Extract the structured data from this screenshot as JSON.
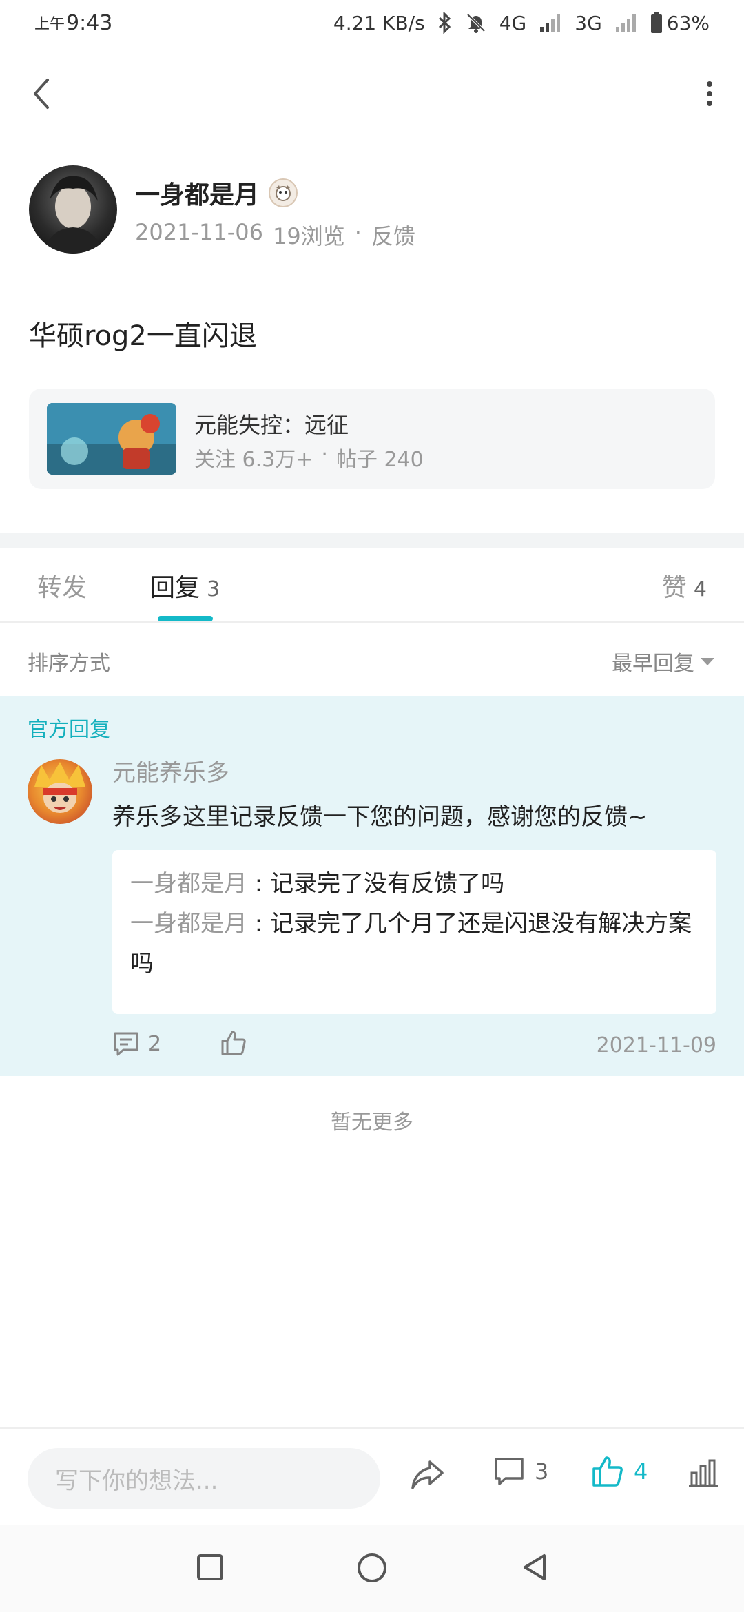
{
  "status": {
    "time_prefix": "上午",
    "time": "9:43",
    "net_speed": "4.21 KB/s",
    "net1": "4G",
    "net2": "3G",
    "battery": "63%"
  },
  "author": {
    "name": "一身都是月",
    "date": "2021-11-06",
    "views": "19浏览",
    "separator": "·",
    "category": "反馈"
  },
  "post": {
    "title": "华硕rog2一直闪退"
  },
  "game": {
    "name": "元能失控：远征",
    "follow": "关注 6.3万+",
    "separator": "·",
    "posts": "帖子 240"
  },
  "tabs": {
    "forward": "转发",
    "reply": "回复",
    "reply_count": "3",
    "like": "赞",
    "like_count": "4"
  },
  "sort": {
    "label": "排序方式",
    "value": "最早回复"
  },
  "official_reply": {
    "tag": "官方回复",
    "author": "元能养乐多",
    "text": "养乐多这里记录反馈一下您的问题，感谢您的反馈~",
    "sub_replies": [
      {
        "author": "一身都是月",
        "sep": " : ",
        "text": "记录完了没有反馈了吗"
      },
      {
        "author": "一身都是月",
        "sep": " : ",
        "text": "记录完了几个月了还是闪退没有解决方案吗"
      }
    ],
    "comment_count": "2",
    "date": "2021-11-09"
  },
  "no_more": "暂无更多",
  "bottom": {
    "input_placeholder": "写下你的想法...",
    "comment_count": "3",
    "like_count": "4"
  },
  "colors": {
    "accent": "#14b9c8",
    "official_bg": "#e6f5f8"
  }
}
